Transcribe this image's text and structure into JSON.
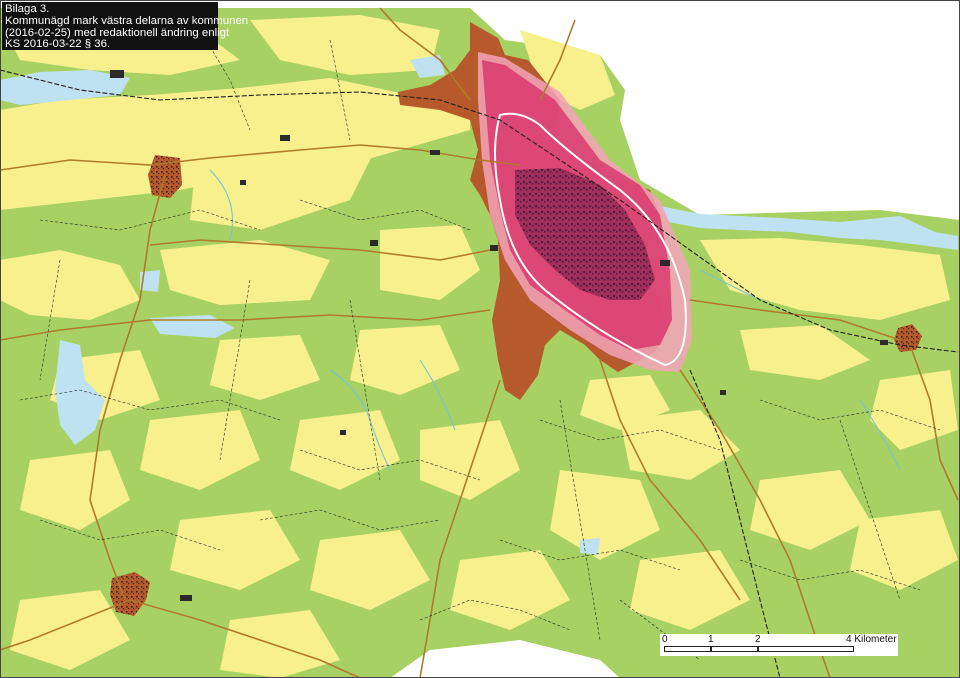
{
  "caption": {
    "line1": "Bilaga 3.",
    "line2": "Kommunägd mark västra delarna av kommunen",
    "line3": "(2016-02-25) med redaktionell ändring enligt",
    "line4": "KS 2016-03-22 § 36."
  },
  "scale": {
    "ticks": [
      "0",
      "1",
      "2",
      "4 Kilometer"
    ],
    "units_km": [
      0,
      1,
      2,
      4
    ]
  },
  "colors": {
    "land": "#a8d163",
    "open_land": "#f7f08d",
    "water": "#bfe2f2",
    "municipal_land": "#b65a2c",
    "urban_zone": "#d8336a",
    "urban_zone_light": "#f3a3b8",
    "roads": "#b07a2a",
    "railway": "#222222"
  }
}
